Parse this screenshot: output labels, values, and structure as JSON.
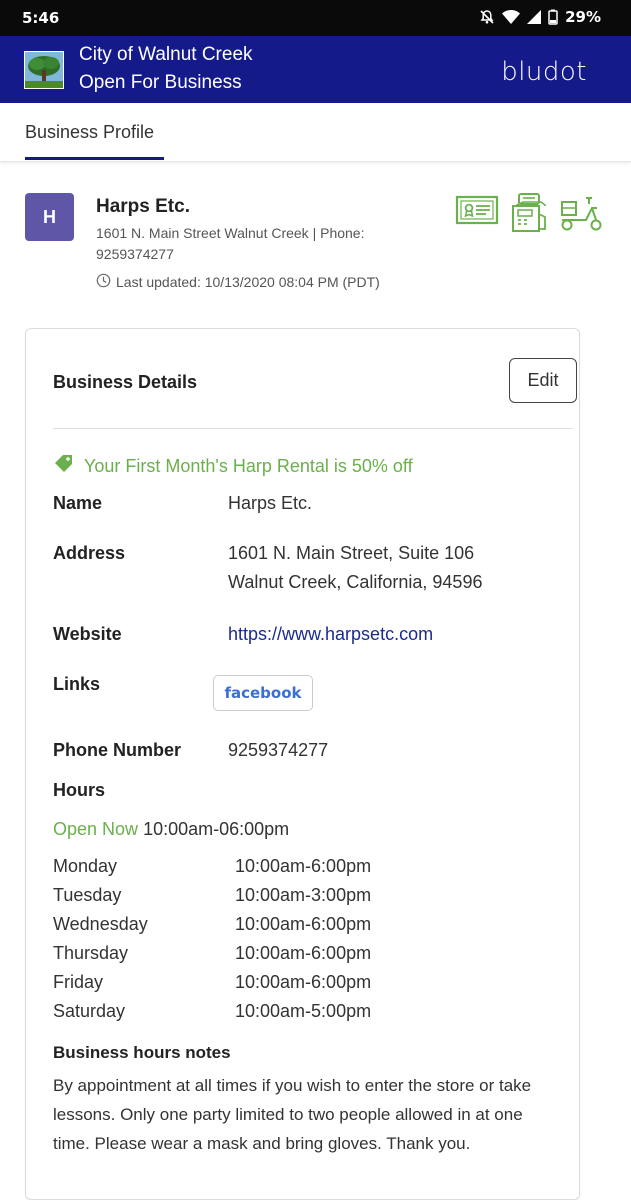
{
  "status_bar": {
    "time": "5:46",
    "battery": "29%",
    "icons": [
      "notifications-off-icon",
      "wifi-icon",
      "signal-icon",
      "battery-icon"
    ]
  },
  "header": {
    "line1": "City of Walnut Creek",
    "line2": "Open For Business",
    "brand": "bludot",
    "color": "#151a8a"
  },
  "tabs": {
    "active": "Business Profile"
  },
  "business": {
    "avatar_letter": "H",
    "name": "Harps Etc.",
    "address_phone": "1601 N. Main Street Walnut Creek | Phone: 9259374277",
    "last_updated": "Last updated: 10/13/2020 08:04 PM (PDT)",
    "action_icons": [
      "certificate-icon",
      "payment-terminal-icon",
      "delivery-scooter-icon"
    ],
    "accent": "#6ab04c"
  },
  "details": {
    "title": "Business Details",
    "edit_label": "Edit",
    "promo": "Your First Month's Harp Rental is 50% off",
    "name_label": "Name",
    "name_value": "Harps Etc.",
    "address_label": "Address",
    "address_line1": "1601 N. Main Street, Suite 106",
    "address_line2": "Walnut Creek, California, 94596",
    "website_label": "Website",
    "website_value": "https://www.harpsetc.com",
    "links_label": "Links",
    "facebook_label": "facebook",
    "phone_label": "Phone Number",
    "phone_value": "9259374277",
    "hours_label": "Hours",
    "open_now": "Open Now",
    "open_hours": "10:00am-06:00pm",
    "hours": [
      {
        "day": "Monday",
        "time": "10:00am-6:00pm"
      },
      {
        "day": "Tuesday",
        "time": "10:00am-3:00pm"
      },
      {
        "day": "Wednesday",
        "time": "10:00am-6:00pm"
      },
      {
        "day": "Thursday",
        "time": "10:00am-6:00pm"
      },
      {
        "day": "Friday",
        "time": "10:00am-6:00pm"
      },
      {
        "day": "Saturday",
        "time": "10:00am-5:00pm"
      }
    ],
    "notes_title": "Business hours notes",
    "notes_text": "By appointment at all times if you wish to enter the store or take lessons. Only one party limited to two people allowed in at one time. Please wear a mask and bring gloves. Thank you."
  }
}
